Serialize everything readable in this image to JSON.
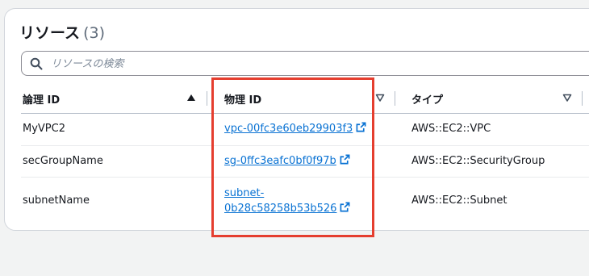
{
  "panel": {
    "title": "リソース",
    "count": "(3)"
  },
  "search": {
    "placeholder": "リソースの検索",
    "value": ""
  },
  "table": {
    "columns": [
      "論理 ID",
      "物理 ID",
      "タイプ"
    ],
    "rows": [
      {
        "logical_id": "MyVPC2",
        "physical_id": "vpc-00fc3e60eb29903f3",
        "type": "AWS::EC2::VPC"
      },
      {
        "logical_id": "secGroupName",
        "physical_id": "sg-0ffc3eafc0bf0f97b",
        "type": "AWS::EC2::SecurityGroup"
      },
      {
        "logical_id": "subnetName",
        "physical_id_line1": "subnet-",
        "physical_id_line2": "0b28c58258b53b526",
        "type": "AWS::EC2::Subnet"
      }
    ]
  },
  "colors": {
    "link": "#0972d3",
    "highlight_border": "#e53e2f"
  }
}
